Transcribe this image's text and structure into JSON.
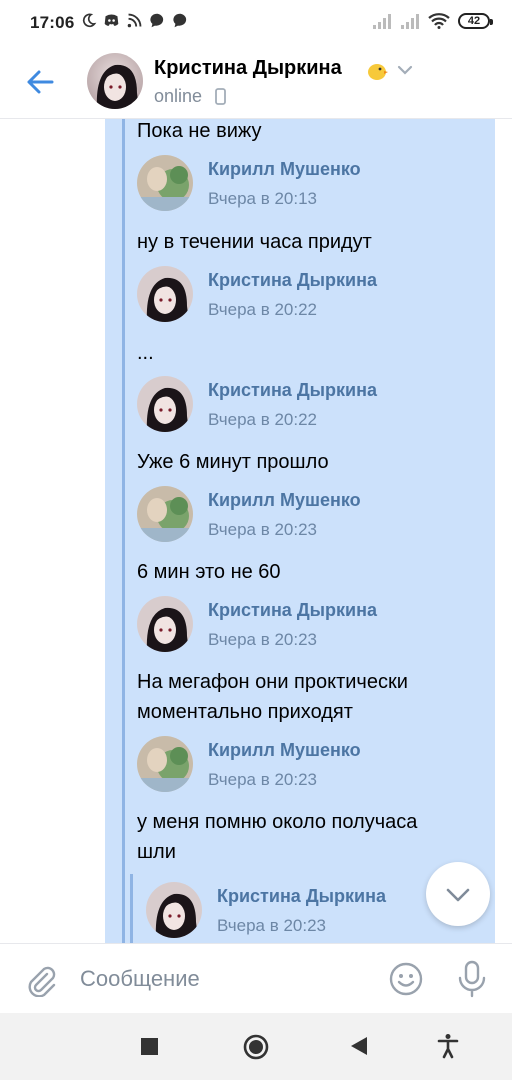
{
  "status_bar": {
    "time": "17:06",
    "battery": "42",
    "icons": [
      "moon-icon",
      "discord-icon",
      "cast-icon",
      "chat-bubble-icon",
      "chat-bubble-icon",
      "signal-icon",
      "signal-icon",
      "wifi-icon",
      "battery-icon"
    ]
  },
  "header": {
    "name": "Кристина Дыркина",
    "status": "online",
    "icons": [
      "back-arrow-icon",
      "chick-emoji-icon",
      "chevron-down-icon",
      "mobile-phone-icon"
    ]
  },
  "colors": {
    "accent": "#4c75a3",
    "forward_bg": "#cce1fb",
    "forward_line": "#8fb4e4",
    "link_blue": "#3f8ae0",
    "muted": "#818c99"
  },
  "messages": [
    {
      "type": "text",
      "text": "Пока не вижу"
    },
    {
      "type": "header",
      "author": "Кирилл Мушенко",
      "time": "Вчера в 20:13"
    },
    {
      "type": "text",
      "text": "ну в течении часа придут"
    },
    {
      "type": "header",
      "author": "Кристина Дыркина",
      "time": "Вчера в 20:22"
    },
    {
      "type": "text",
      "text": "..."
    },
    {
      "type": "header",
      "author": "Кристина Дыркина",
      "time": "Вчера в 20:22"
    },
    {
      "type": "text",
      "text": "Уже 6 минут прошло"
    },
    {
      "type": "header",
      "author": "Кирилл Мушенко",
      "time": "Вчера в 20:23"
    },
    {
      "type": "text",
      "text": "6 мин это не 60"
    },
    {
      "type": "header",
      "author": "Кристина Дыркина",
      "time": "Вчера в 20:23"
    },
    {
      "type": "text",
      "text": "На мегафон они проктически\nмоментально приходят"
    },
    {
      "type": "header",
      "author": "Кирилл Мушенко",
      "time": "Вчера в 20:23"
    },
    {
      "type": "text",
      "text": "у меня помню около получаса\nшли"
    },
    {
      "type": "header",
      "author": "Кристина Дыркина",
      "time": "Вчера в 20:23"
    }
  ],
  "composer": {
    "placeholder": "Сообщение",
    "icons": [
      "paperclip-icon",
      "emoji-smile-icon",
      "microphone-icon"
    ]
  },
  "scroll_button": {
    "icon": "chevron-down-icon"
  },
  "nav_bar": {
    "icons": [
      "recents-square-icon",
      "home-circle-icon",
      "back-triangle-icon",
      "accessibility-icon"
    ]
  }
}
